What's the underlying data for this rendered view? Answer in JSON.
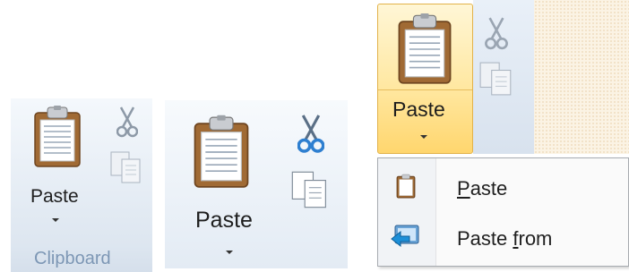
{
  "panel_small": {
    "paste_label": "Paste",
    "group_label": "Clipboard"
  },
  "panel_medium": {
    "paste_label": "Paste"
  },
  "panel_open": {
    "paste_label": "Paste",
    "menu": {
      "items": [
        {
          "label_hotkey": "P",
          "label_rest": "aste",
          "icon": "clipboard-icon"
        },
        {
          "label_pre": "Paste ",
          "label_hotkey": "f",
          "label_rest": "rom",
          "icon": "paste-from-icon"
        }
      ]
    }
  },
  "icons": [
    "clipboard-icon",
    "scissors-icon",
    "copy-icon",
    "paste-from-icon",
    "dropdown-arrow-icon"
  ],
  "colors": {
    "hover_highlight": "#ffe8a2",
    "ribbon_bg": "#dde6f0",
    "group_label": "#7d97b5"
  }
}
